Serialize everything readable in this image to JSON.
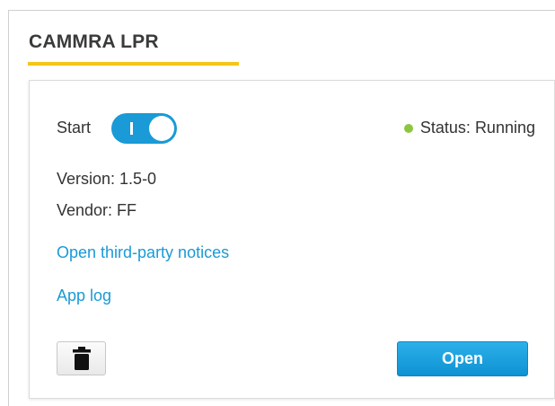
{
  "app": {
    "title": "CAMMRA LPR"
  },
  "card": {
    "start_label": "Start",
    "toggle": {
      "state": "on",
      "on_mark": "I"
    },
    "status": {
      "text": "Status: Running",
      "dot_color": "#8cc63f"
    },
    "version": "Version: 1.5-0",
    "vendor": "Vendor: FF",
    "links": {
      "third_party": "Open third-party notices",
      "app_log": "App log"
    },
    "buttons": {
      "delete_icon": "trash-icon",
      "open_label": "Open"
    }
  },
  "colors": {
    "accent": "#1a9ad6",
    "underline": "#f5c518",
    "title_text": "#3a3a3a"
  }
}
